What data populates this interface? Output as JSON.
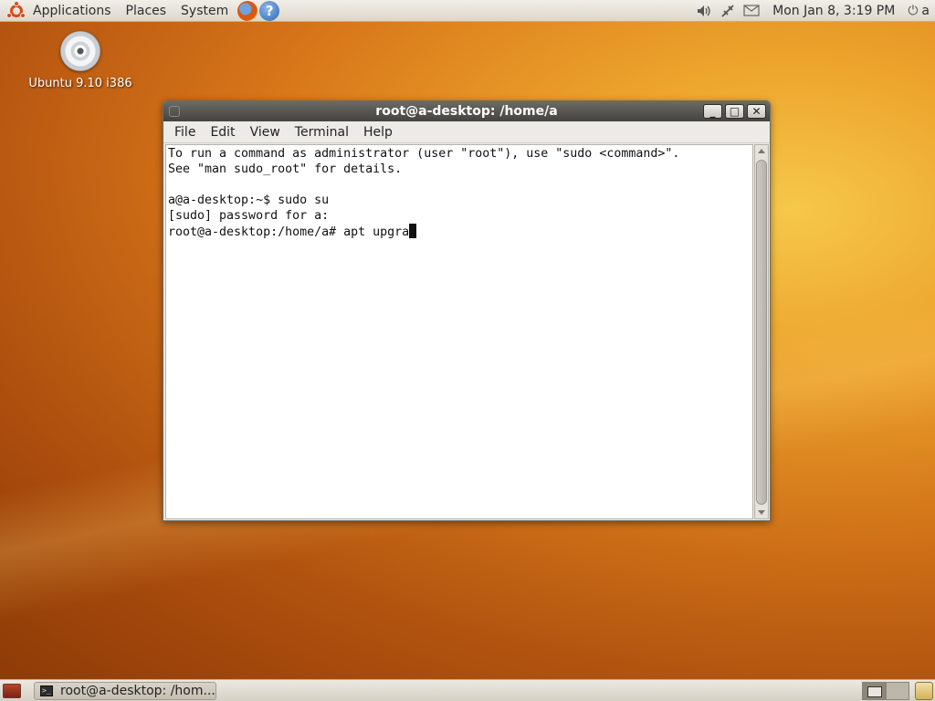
{
  "top_panel": {
    "menus": [
      "Applications",
      "Places",
      "System"
    ],
    "launchers": [
      "firefox-icon",
      "help-icon"
    ],
    "help_glyph": "?",
    "tray_icons": [
      "volume-icon",
      "network-icon",
      "mail-icon"
    ],
    "clock": "Mon Jan  8, 3:19 PM",
    "user": "a",
    "power_glyph": "⏻"
  },
  "desktop": {
    "icons": [
      {
        "label": "Ubuntu 9.10 i386",
        "icon": "cd-icon"
      }
    ]
  },
  "window": {
    "title": "root@a-desktop: /home/a",
    "buttons": {
      "minimize": "_",
      "maximize": "□",
      "close": "✕"
    },
    "menubar": [
      "File",
      "Edit",
      "View",
      "Terminal",
      "Help"
    ],
    "terminal_lines": [
      "To run a command as administrator (user \"root\"), use \"sudo <command>\".",
      "See \"man sudo_root\" for details.",
      "",
      "a@a-desktop:~$ sudo su",
      "[sudo] password for a:",
      "root@a-desktop:/home/a# apt upgra"
    ]
  },
  "bottom_panel": {
    "task": "root@a-desktop: /hom...",
    "workspaces": 2,
    "active_workspace": 1
  },
  "colors": {
    "accent": "#dd4814",
    "titlebar": "#4f4d49",
    "panel": "#e6e2da"
  }
}
